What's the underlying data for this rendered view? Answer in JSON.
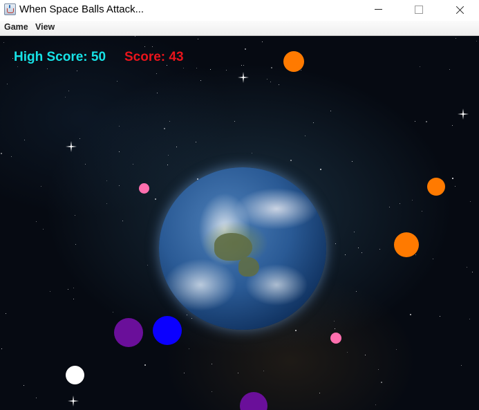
{
  "window": {
    "title": "When Space Balls Attack..."
  },
  "menu": {
    "items": [
      "Game",
      "View"
    ]
  },
  "hud": {
    "high_score_text": "High Score: 50",
    "score_text": "Score: 43",
    "high_score": 50,
    "score": 43
  },
  "colors": {
    "high_score": "#17e2e6",
    "score": "#e8141b",
    "ball_orange": "#ff7a00",
    "ball_pink": "#ff6fae",
    "ball_purple": "#6a0f9a",
    "ball_blue": "#0b00ff",
    "ball_white": "#ffffff"
  },
  "balls": [
    {
      "color": "orange"
    },
    {
      "color": "pink"
    },
    {
      "color": "orange"
    },
    {
      "color": "orange"
    },
    {
      "color": "purple"
    },
    {
      "color": "blue"
    },
    {
      "color": "pink"
    },
    {
      "color": "white"
    },
    {
      "color": "purple"
    }
  ]
}
